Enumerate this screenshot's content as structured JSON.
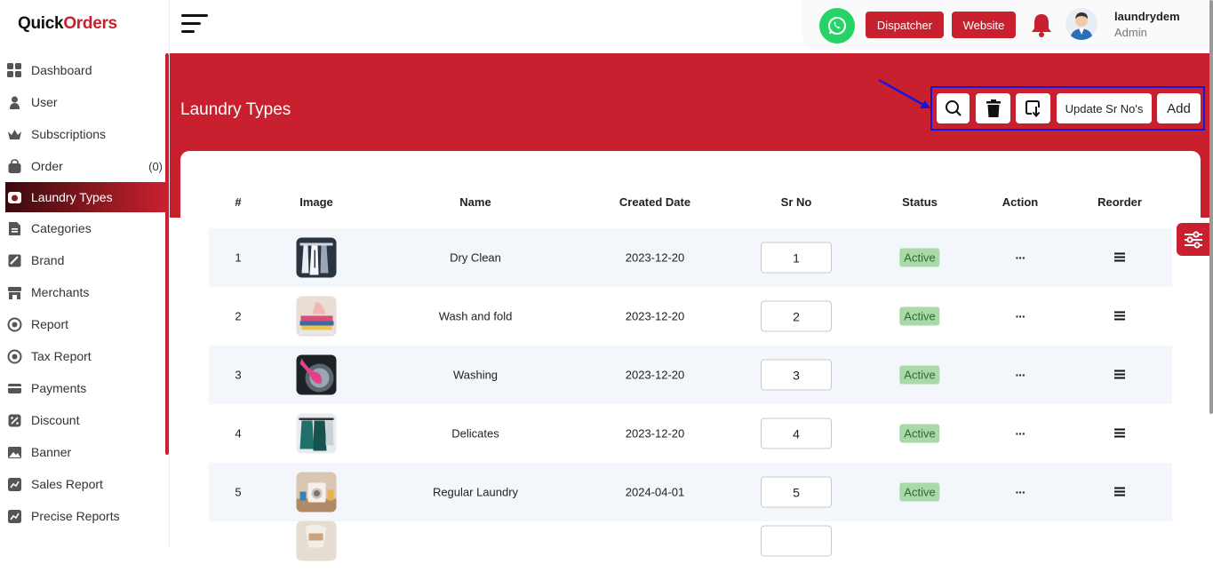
{
  "brand": {
    "logo_part1": "Quick",
    "logo_part2": "Orders"
  },
  "sidebar": {
    "items": [
      {
        "label": "Dashboard",
        "icon": "dashboard-icon"
      },
      {
        "label": "User",
        "icon": "user-icon"
      },
      {
        "label": "Subscriptions",
        "icon": "crown-icon"
      },
      {
        "label": "Order",
        "icon": "bag-icon",
        "count": "(0)"
      },
      {
        "label": "Laundry Types",
        "icon": "laundry-icon",
        "active": true
      },
      {
        "label": "Categories",
        "icon": "categories-icon"
      },
      {
        "label": "Brand",
        "icon": "brand-icon"
      },
      {
        "label": "Merchants",
        "icon": "store-icon"
      },
      {
        "label": "Report",
        "icon": "report-icon"
      },
      {
        "label": "Tax Report",
        "icon": "tax-report-icon"
      },
      {
        "label": "Payments",
        "icon": "payments-icon"
      },
      {
        "label": "Discount",
        "icon": "discount-icon"
      },
      {
        "label": "Banner",
        "icon": "image-icon"
      },
      {
        "label": "Sales Report",
        "icon": "chart-icon"
      },
      {
        "label": "Precise Reports",
        "icon": "chart-icon"
      }
    ]
  },
  "topbar": {
    "dispatcher_label": "Dispatcher",
    "website_label": "Website",
    "user_name": "laundrydem",
    "user_role": "Admin"
  },
  "page": {
    "title": "Laundry Types",
    "update_sr_label": "Update Sr No's",
    "add_label": "Add"
  },
  "table": {
    "headers": [
      "#",
      "Image",
      "Name",
      "Created Date",
      "Sr No",
      "Status",
      "Action",
      "Reorder"
    ],
    "rows": [
      {
        "num": "1",
        "name": "Dry Clean",
        "date": "2023-12-20",
        "sr": "1",
        "status": "Active",
        "action": "···"
      },
      {
        "num": "2",
        "name": "Wash and fold",
        "date": "2023-12-20",
        "sr": "2",
        "status": "Active",
        "action": "···"
      },
      {
        "num": "3",
        "name": "Washing",
        "date": "2023-12-20",
        "sr": "3",
        "status": "Active",
        "action": "···"
      },
      {
        "num": "4",
        "name": "Delicates",
        "date": "2023-12-20",
        "sr": "4",
        "status": "Active",
        "action": "···"
      },
      {
        "num": "5",
        "name": "Regular Laundry",
        "date": "2024-04-01",
        "sr": "5",
        "status": "Active",
        "action": "···"
      }
    ]
  },
  "colors": {
    "accent": "#c8202f",
    "status_bg": "#a9d9a9",
    "highlight": "#1515e0"
  }
}
